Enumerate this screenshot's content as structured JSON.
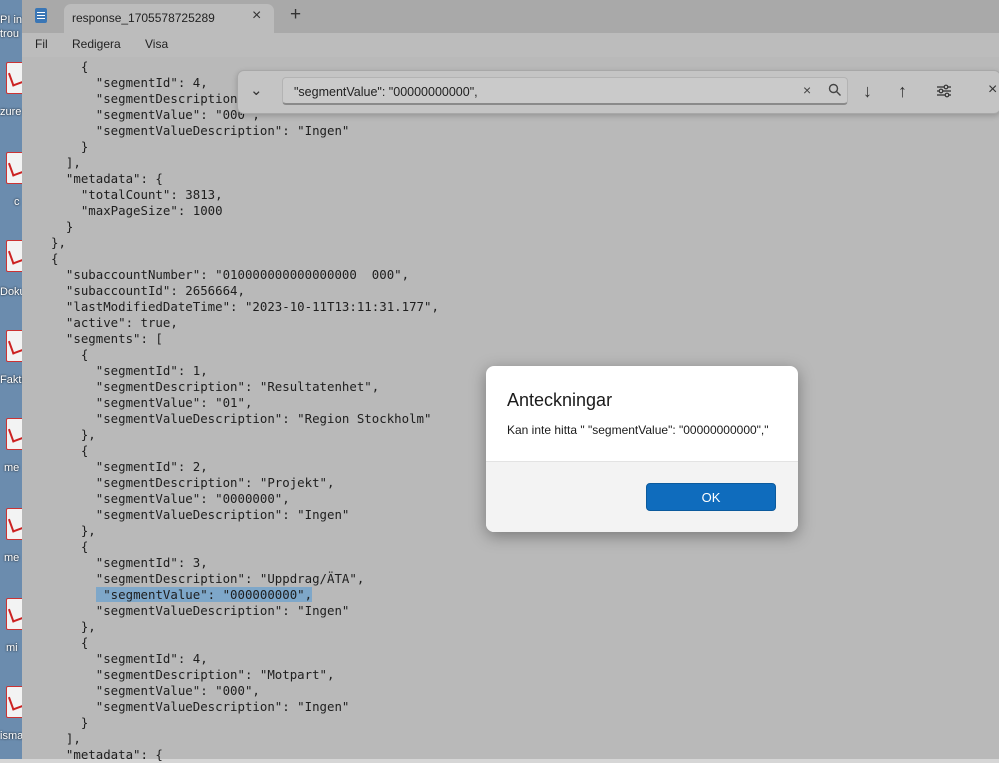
{
  "desktop": {
    "labels": [
      "PI in",
      "trou",
      "zure",
      "c",
      "Doku",
      "Faktu",
      "me",
      "me",
      "mi",
      "isma"
    ]
  },
  "window": {
    "tab_title": "response_1705578725289",
    "menu": [
      "Fil",
      "Redigera",
      "Visa"
    ]
  },
  "editor": {
    "lines": [
      "    {",
      "      \"segmentId\": 4,",
      "      \"segmentDescription\": \"M",
      "      \"segmentValue\": \"000\",",
      "      \"segmentValueDescription\": \"Ingen\"",
      "    }",
      "  ],",
      "  \"metadata\": {",
      "    \"totalCount\": 3813,",
      "    \"maxPageSize\": 1000",
      "  }",
      "},",
      "{",
      "  \"subaccountNumber\": \"010000000000000000  000\",",
      "  \"subaccountId\": 2656664,",
      "  \"lastModifiedDateTime\": \"2023-10-11T13:11:31.177\",",
      "  \"active\": true,",
      "  \"segments\": [",
      "    {",
      "      \"segmentId\": 1,",
      "      \"segmentDescription\": \"Resultatenhet\",",
      "      \"segmentValue\": \"01\",",
      "      \"segmentValueDescription\": \"Region Stockholm\"",
      "    },",
      "    {",
      "      \"segmentId\": 2,",
      "      \"segmentDescription\": \"Projekt\",",
      "      \"segmentValue\": \"0000000\",",
      "      \"segmentValueDescription\": \"Ingen\"",
      "    },",
      "    {",
      "      \"segmentId\": 3,",
      "      \"segmentDescription\": \"Uppdrag/ÄTA\",",
      "      \"segmentValue\": \"000000000\",",
      "      \"segmentValueDescription\": \"Ingen\"",
      "    },",
      "    {",
      "      \"segmentId\": 4,",
      "      \"segmentDescription\": \"Motpart\",",
      "      \"segmentValue\": \"000\",",
      "      \"segmentValueDescription\": \"Ingen\"",
      "    }",
      "  ],",
      "  \"metadata\": {"
    ],
    "highlight": {
      "line": 33,
      "prefix": "      ",
      "text": " \"segmentValue\": \"000000000\",",
      "rest": ""
    }
  },
  "find": {
    "query": "\"segmentValue\": \"00000000000\","
  },
  "dialog": {
    "title": "Anteckningar",
    "message": "Kan inte hitta \" \"segmentValue\": \"00000000000\",\"",
    "ok_label": "OK"
  },
  "colors": {
    "accent": "#0f6cbd",
    "selection": "#7ea7c9"
  }
}
